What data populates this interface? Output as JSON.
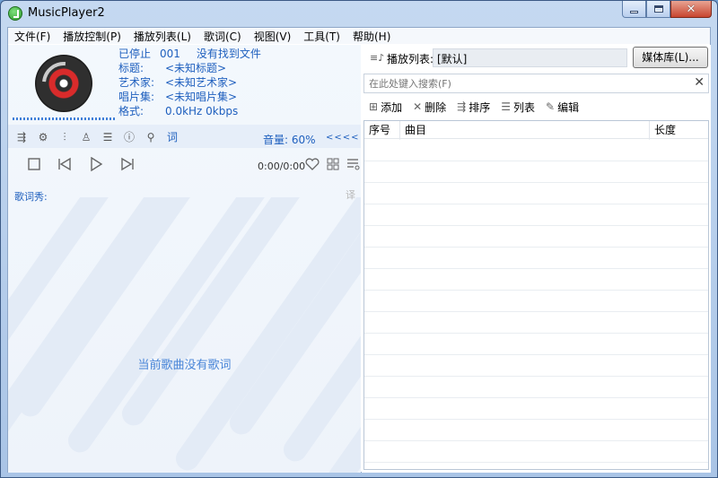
{
  "window": {
    "title": "MusicPlayer2"
  },
  "menu": [
    "文件(F)",
    "播放控制(P)",
    "播放列表(L)",
    "歌词(C)",
    "视图(V)",
    "工具(T)",
    "帮助(H)"
  ],
  "now_playing": {
    "status": "已停止",
    "index": "001",
    "message": "没有找到文件",
    "rows": [
      {
        "label": "标题:",
        "value": "<未知标题>"
      },
      {
        "label": "艺术家:",
        "value": "<未知艺术家>"
      },
      {
        "label": "唱片集:",
        "value": "<未知唱片集>"
      },
      {
        "label": "格式:",
        "value": "0.0kHz 0kbps"
      }
    ]
  },
  "toolbar": {
    "lyric_btn": "词",
    "volume": "音量: 60%",
    "arrows": "<<<<"
  },
  "playback": {
    "time": "0:00/0:00"
  },
  "lyrics": {
    "label": "歌词秀:",
    "translate_icon": "译",
    "empty_message": "当前歌曲没有歌词"
  },
  "playlist": {
    "label": "播放列表:",
    "name": "[默认]",
    "media_library_button": "媒体库(L)...",
    "search_placeholder": "在此处键入搜索(F)",
    "tools": [
      {
        "icon": "plus-icon",
        "label": "添加"
      },
      {
        "icon": "delete-icon",
        "label": "删除"
      },
      {
        "icon": "sort-icon",
        "label": "排序"
      },
      {
        "icon": "list-icon",
        "label": "列表"
      },
      {
        "icon": "edit-icon",
        "label": "编辑"
      }
    ],
    "columns": [
      "序号",
      "曲目",
      "长度"
    ]
  }
}
